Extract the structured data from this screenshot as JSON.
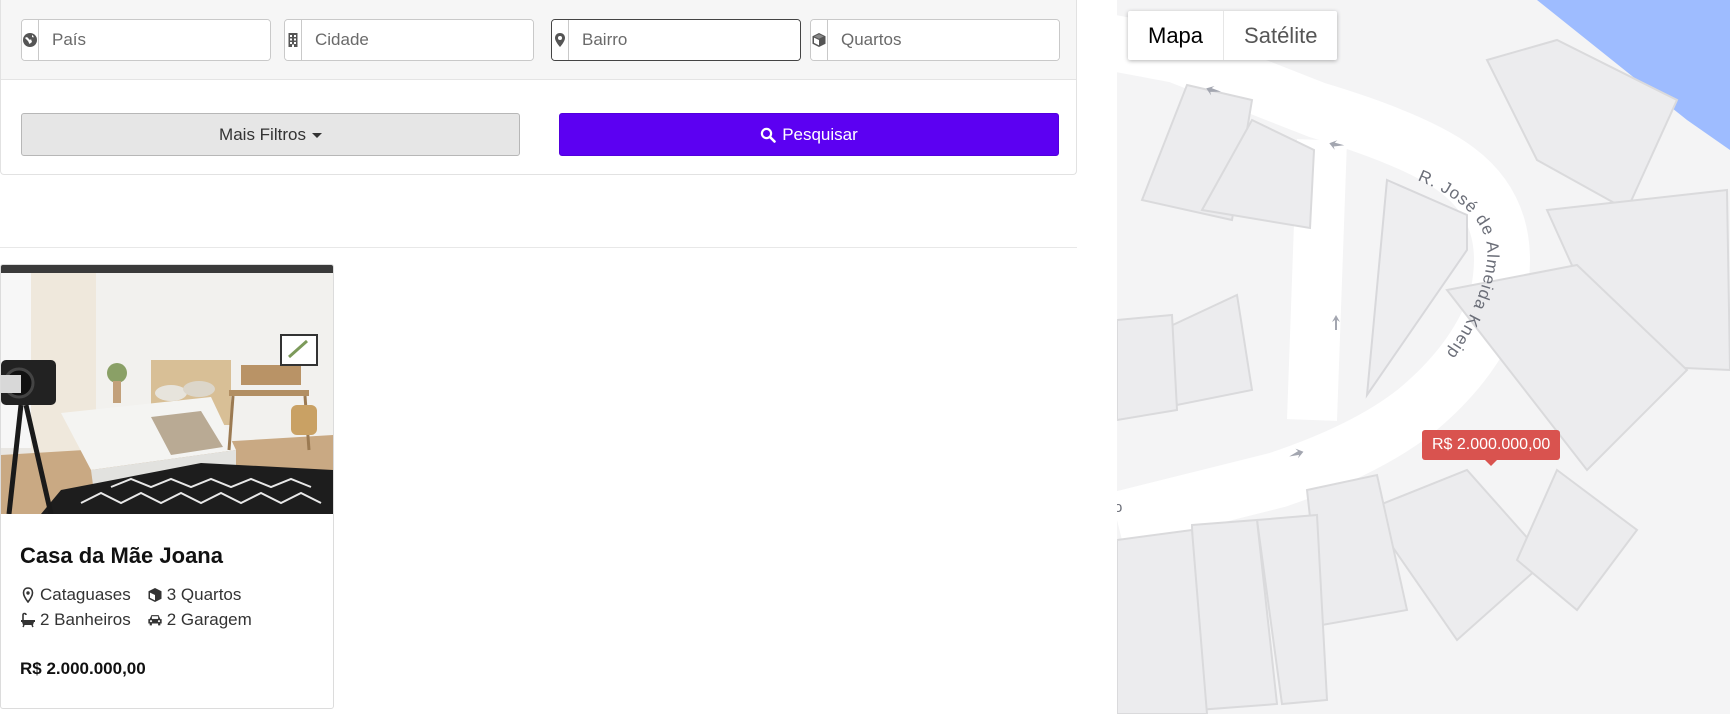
{
  "filters": {
    "country_placeholder": "País",
    "city_placeholder": "Cidade",
    "neighborhood_placeholder": "Bairro",
    "rooms_placeholder": "Quartos",
    "more_filters_label": "Mais Filtros",
    "search_label": "Pesquisar"
  },
  "listing": {
    "title": "Casa da Mãe Joana",
    "city": "Cataguases",
    "rooms": "3 Quartos",
    "bathrooms": "2 Banheiros",
    "garage": "2 Garagem",
    "price": "R$ 2.000.000,00"
  },
  "map": {
    "tab_map": "Mapa",
    "tab_satellite": "Satélite",
    "street_name": "R. José de Almeida Kneip",
    "edge_label": "o",
    "marker_price": "R$ 2.000.000,00"
  },
  "colors": {
    "search_button": "#5c00f2",
    "marker": "#d9534f",
    "water": "#9ebcff"
  }
}
